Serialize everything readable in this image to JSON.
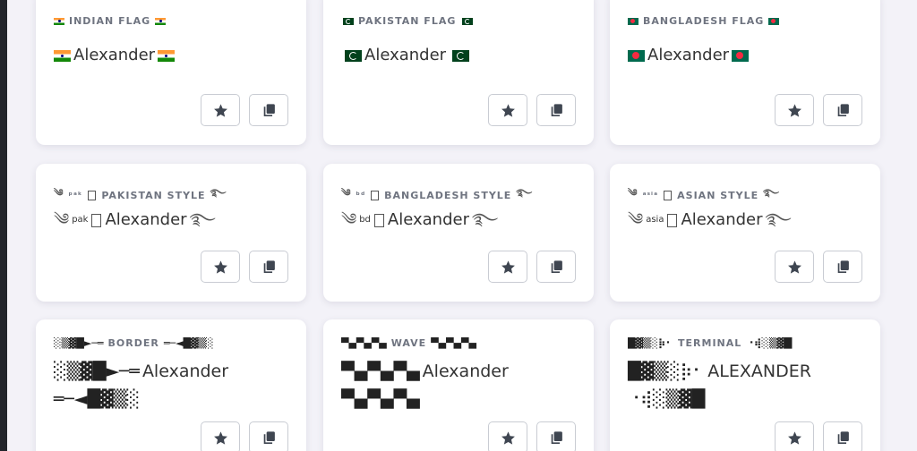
{
  "cards": [
    {
      "label": "INDIAN FLAG",
      "name": "Alexander",
      "flag": "india-flag"
    },
    {
      "label": "PAKISTAN FLAG",
      "name": "Alexander",
      "flag": "pakistan-flag"
    },
    {
      "label": "BANGLADESH FLAG",
      "name": "Alexander",
      "flag": "bangladesh-flag"
    },
    {
      "label": "PAKISTAN STYLE",
      "name": "Alexander",
      "sup": "pak",
      "label_sup": "ᵖᵃᵏ"
    },
    {
      "label": "BANGLADESH STYLE",
      "name": "Alexander",
      "sup": "bd",
      "label_sup": "ᵇᵈ"
    },
    {
      "label": "ASIAN STYLE",
      "name": "Alexander",
      "sup": "asia",
      "label_sup": "ᵃˢⁱᵃ"
    },
    {
      "label": "BORDER",
      "name": "Alexander",
      "deco_left": "░▒▓█►─═",
      "deco_right": "═─◄█▓▒░",
      "label_left": "░▒▓█►─═",
      "label_right": "═─◄█▓▒░"
    },
    {
      "label": "WAVE",
      "name": "Alexander",
      "deco_left": "▀▄▀▄▀▄",
      "deco_right": "▀▄▀▄▀▄",
      "label_left": "▀▄▀▄▀▄",
      "label_right": "▀▄▀▄▀▄"
    },
    {
      "label": "TERMINAL",
      "name": "ALEXANDER",
      "deco_left": "█▓▒░⡷⠂",
      "deco_right": "⠐⢾░▒▓█",
      "label_left": "█▓▒░⡷⠂",
      "label_right": "⠐⢾░▒▓█"
    }
  ],
  "decor": {
    "hand": "༄",
    "eye": "࿐"
  },
  "buttons": {
    "favorite": "star-icon",
    "copy": "copy-icon"
  }
}
